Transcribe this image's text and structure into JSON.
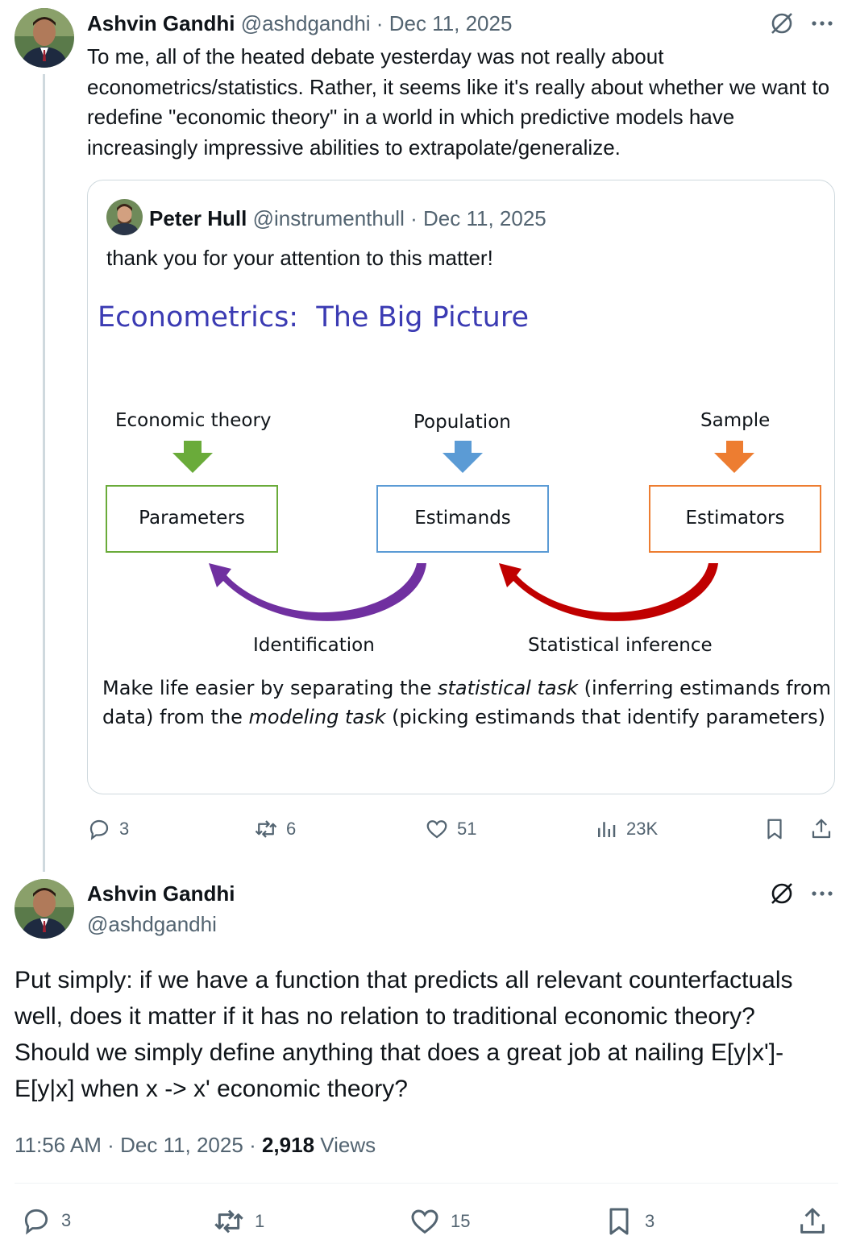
{
  "tweet1": {
    "author_name": "Ashvin Gandhi",
    "handle": "@ashdgandhi",
    "separator": "·",
    "date": "Dec 11, 2025",
    "text": "To me, all of the heated debate yesterday was not really about econometrics/statistics. Rather, it seems like it's really about whether we want to redefine \"economic theory\" in a world in which predictive models have increasingly impressive abilities to extrapolate/generalize.",
    "quote": {
      "author_name": "Peter Hull",
      "handle": "@instrumenthull",
      "separator": "·",
      "date": "Dec 11, 2025",
      "text": "thank you for your attention to this matter!",
      "slide": {
        "title": "Econometrics:  The Big Picture",
        "top_labels": [
          "Economic theory",
          "Population",
          "Sample"
        ],
        "boxes": [
          "Parameters",
          "Estimands",
          "Estimators"
        ],
        "arc_labels": [
          "Identification",
          "Statistical inference"
        ],
        "caption_line1_a": "Make life easier by separating the ",
        "caption_line1_em": "statistical task",
        "caption_line1_b": " (inferring estimands from",
        "caption_line2_a": "data) from the ",
        "caption_line2_em": "modeling task",
        "caption_line2_b": " (picking estimands that identify parameters)",
        "colors": {
          "title": "#3b3bb3",
          "green": "#6aab3a",
          "blue": "#5b9bd5",
          "orange": "#ed7d31",
          "purple": "#7030a0",
          "red": "#c00000"
        }
      }
    },
    "stats": {
      "replies": "3",
      "reposts": "6",
      "likes": "51",
      "views": "23K"
    }
  },
  "tweet2": {
    "author_name": "Ashvin Gandhi",
    "handle": "@ashdgandhi",
    "text": "Put simply: if we have a function that predicts all relevant counterfactuals well, does it matter if it has no relation to traditional economic theory? Should we simply define anything that does a great job at nailing E[y|x']-E[y|x] when x -> x' economic theory?",
    "time": "11:56 AM",
    "separator": "·",
    "date": "Dec 11, 2025",
    "separator2": "·",
    "views_count": "2,918",
    "views_label": "Views",
    "stats": {
      "replies": "3",
      "reposts": "1",
      "likes": "15",
      "bookmarks": "3"
    }
  }
}
